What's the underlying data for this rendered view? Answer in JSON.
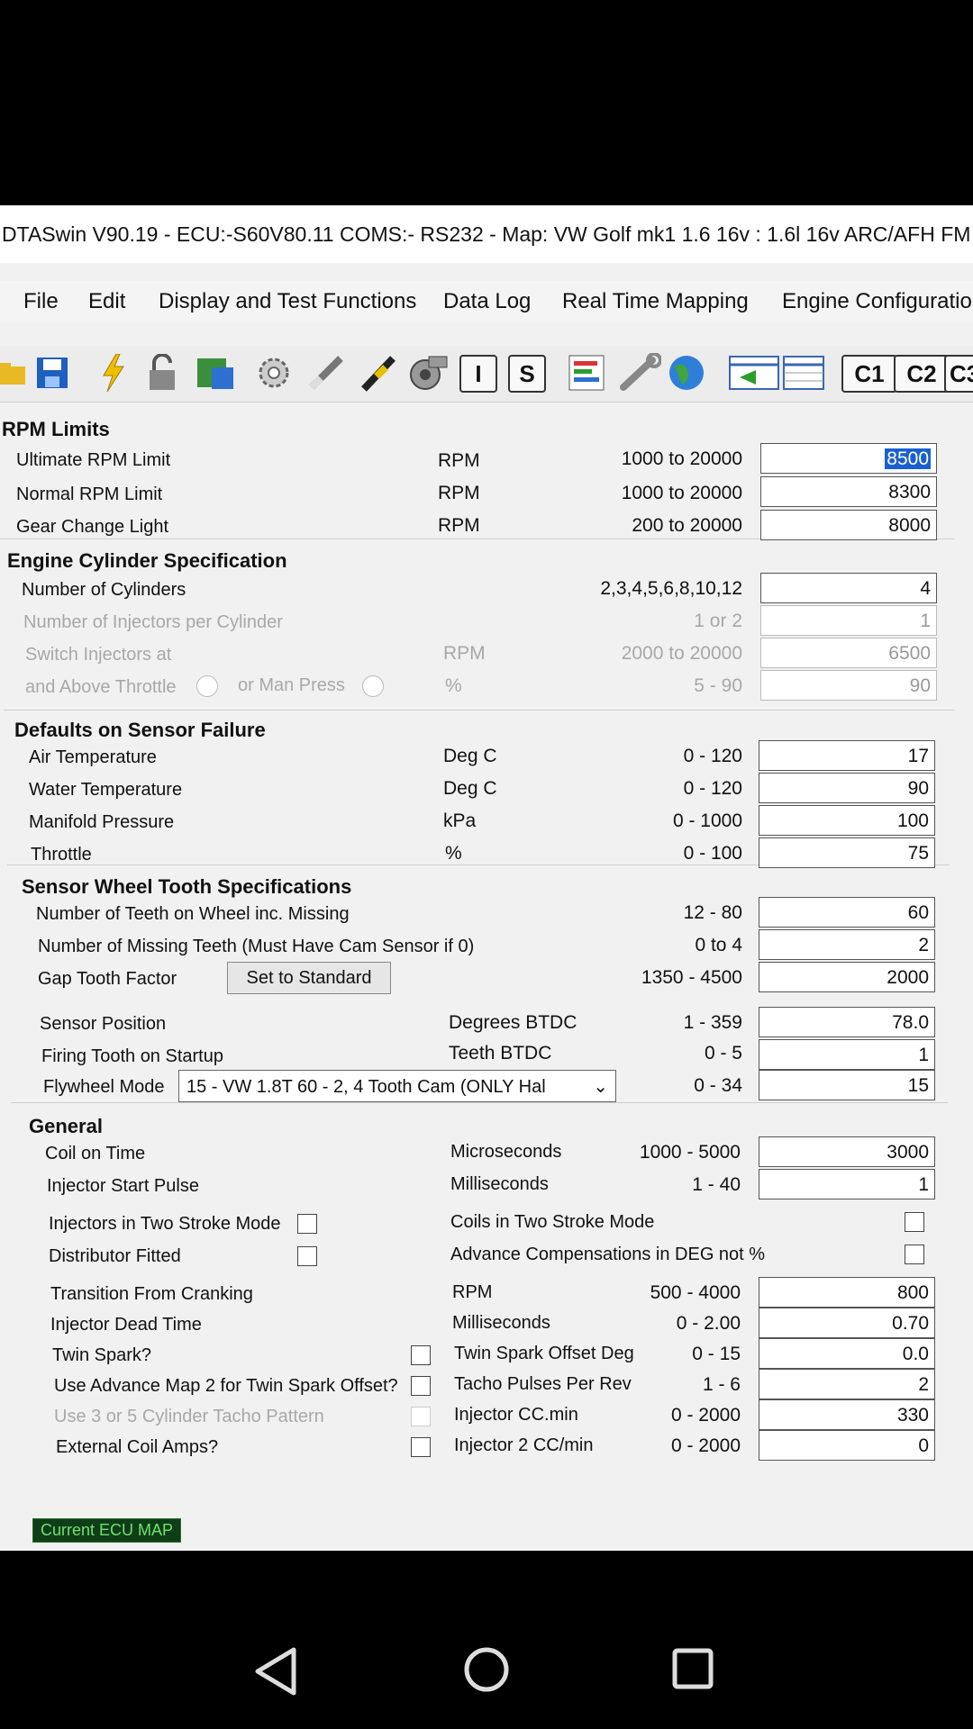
{
  "window": {
    "title": "DTASwin V90.19 - ECU:-S60V80.11 COMS:- RS232  - Map: VW Golf mk1 1.6 16v : 1.6l  16v ARC/AFH FM"
  },
  "menu": [
    "File",
    "Edit",
    "Display and Test Functions",
    "Data Log",
    "Real Time Mapping",
    "Engine Configuratio"
  ],
  "toolbar": {
    "icons": [
      "folder-icon",
      "save-icon",
      "lightning-icon",
      "lock-icon",
      "chip-icon",
      "gear-icon",
      "spark-plug-icon",
      "injector-icon",
      "turbo-icon",
      "i-icon",
      "s-icon",
      "chart-icon",
      "wrench-icon",
      "globe-icon",
      "table-arrow-icon",
      "table-icon"
    ],
    "i_label": "I",
    "s_label": "S",
    "c1": "C1",
    "c2": "C2",
    "c3": "C3"
  },
  "rpm_limits": {
    "title": "RPM Limits",
    "rows": [
      {
        "label": "Ultimate RPM Limit",
        "unit": "RPM",
        "range": "1000 to 20000",
        "value": "8500"
      },
      {
        "label": "Normal RPM Limit",
        "unit": "RPM",
        "range": "1000 to 20000",
        "value": "8300"
      },
      {
        "label": "Gear Change Light",
        "unit": "RPM",
        "range": "200 to 20000",
        "value": "8000"
      }
    ]
  },
  "engine_cyl": {
    "title": "Engine Cylinder Specification",
    "rows": [
      {
        "label": "Number of Cylinders",
        "unit": "",
        "range": "2,3,4,5,6,8,10,12",
        "value": "4"
      },
      {
        "label": "Number of Injectors per Cylinder",
        "unit": "",
        "range": "1 or 2",
        "value": "1"
      },
      {
        "label": "Switch Injectors at",
        "unit": "RPM",
        "range": "2000 to 20000",
        "value": "6500"
      },
      {
        "label": "and Above Throttle",
        "unit": "%",
        "range": "5 - 90",
        "value": "90"
      }
    ],
    "or_man_press": "or Man Press"
  },
  "defaults": {
    "title": "Defaults on Sensor Failure",
    "rows": [
      {
        "label": "Air Temperature",
        "unit": "Deg C",
        "range": "0 - 120",
        "value": "17"
      },
      {
        "label": "Water Temperature",
        "unit": "Deg C",
        "range": "0 - 120",
        "value": "90"
      },
      {
        "label": "Manifold Pressure",
        "unit": "kPa",
        "range": "0 - 1000",
        "value": "100"
      },
      {
        "label": "Throttle",
        "unit": "%",
        "range": "0 - 100",
        "value": "75"
      }
    ]
  },
  "wheel": {
    "title": "Sensor Wheel Tooth Specifications",
    "rows": [
      {
        "label": "Number of Teeth on Wheel inc. Missing",
        "unit": "",
        "range": "12 - 80",
        "value": "60"
      },
      {
        "label": "Number of Missing Teeth (Must Have Cam Sensor if 0)",
        "unit": "",
        "range": "0 to 4",
        "value": "2"
      },
      {
        "label": "Gap Tooth Factor",
        "unit": "",
        "range": "1350 - 4500",
        "value": "2000"
      },
      {
        "label": "Sensor Position",
        "unit": "Degrees BTDC",
        "range": "1 - 359",
        "value": "78.0"
      },
      {
        "label": "Firing Tooth on Startup",
        "unit": "Teeth BTDC",
        "range": "0 - 5",
        "value": "1"
      },
      {
        "label": "Flywheel Mode",
        "unit": "",
        "range": "0 - 34",
        "value": "15"
      }
    ],
    "set_std": "Set to Standard",
    "flywheel_option": "15 - VW 1.8T 60 - 2, 4 Tooth Cam (ONLY Hal"
  },
  "general": {
    "title": "General",
    "coil_on": {
      "label": "Coil on Time",
      "unit": "Microseconds",
      "range": "1000 - 5000",
      "value": "3000"
    },
    "inj_start": {
      "label": "Injector Start Pulse",
      "unit": "Milliseconds",
      "range": "1 - 40",
      "value": "1"
    },
    "inj_two_stroke": "Injectors in Two Stroke Mode",
    "dist_fitted": "Distributor Fitted",
    "coils_two_stroke": "Coils in Two Stroke Mode",
    "adv_comp": "Advance Compensations in DEG not %",
    "left_labels": [
      "Transition From Cranking",
      "Injector Dead Time",
      "Twin Spark?",
      "Use Advance Map 2 for Twin Spark Offset?",
      "Use 3 or 5 Cylinder Tacho Pattern",
      "External Coil Amps?"
    ],
    "rows": [
      {
        "unit": "RPM",
        "range": "500 - 4000",
        "value": "800"
      },
      {
        "unit": "Milliseconds",
        "range": "0 - 2.00",
        "value": "0.70"
      },
      {
        "unit": "Twin Spark Offset Deg",
        "range": "0 - 15",
        "value": "0.0"
      },
      {
        "unit": "Tacho Pulses Per Rev",
        "range": "1 - 6",
        "value": "2"
      },
      {
        "unit": "Injector CC.min",
        "range": "0 - 2000",
        "value": "330"
      },
      {
        "unit": "Injector 2 CC/min",
        "range": "0 - 2000",
        "value": "0"
      }
    ]
  },
  "status": "Current ECU MAP"
}
